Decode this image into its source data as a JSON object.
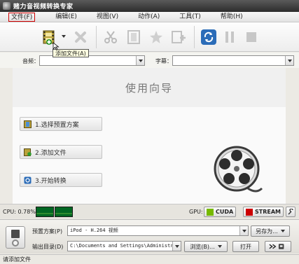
{
  "window": {
    "title": "赌力音视频转换专家"
  },
  "menu": [
    {
      "label": "文件(F)"
    },
    {
      "label": "编辑(E)"
    },
    {
      "label": "视图(V)"
    },
    {
      "label": "动作(A)"
    },
    {
      "label": "工具(T)"
    },
    {
      "label": "帮助(H)"
    }
  ],
  "toolbar": {
    "add_file_tooltip": "添加文件(A)",
    "icons": [
      "add-file",
      "remove",
      "cut",
      "clip",
      "effect",
      "merge",
      "convert",
      "pause",
      "stop"
    ]
  },
  "tracks": {
    "audio_label": "音频：",
    "audio_value": "",
    "subtitle_label": "字幕：",
    "subtitle_value": ""
  },
  "wizard": {
    "title": "使用向导",
    "steps": [
      {
        "label": "1.选择预置方案"
      },
      {
        "label": "2.添加文件"
      },
      {
        "label": "3.开始转换"
      }
    ]
  },
  "status_strip": {
    "cpu_label": "CPU: 0.78%",
    "gpu_label": "GPU:",
    "cuda_label": "CUDA",
    "stream_label": "STREAM"
  },
  "output": {
    "preset_label": "预置方案(P)",
    "preset_value": "iPod - H.264 视频",
    "save_as_label": "另存为...",
    "dir_label": "输出目录(D)",
    "dir_value": "C:\\Documents and Settings\\Administrat",
    "browse_label": "浏览(B)...",
    "open_label": "打开"
  },
  "statusbar": {
    "text": "请添加文件"
  },
  "colors": {
    "menu_highlight": "#d00000",
    "titlebar": "#3a3a3a",
    "convert_blue": "#2b6cb8"
  }
}
